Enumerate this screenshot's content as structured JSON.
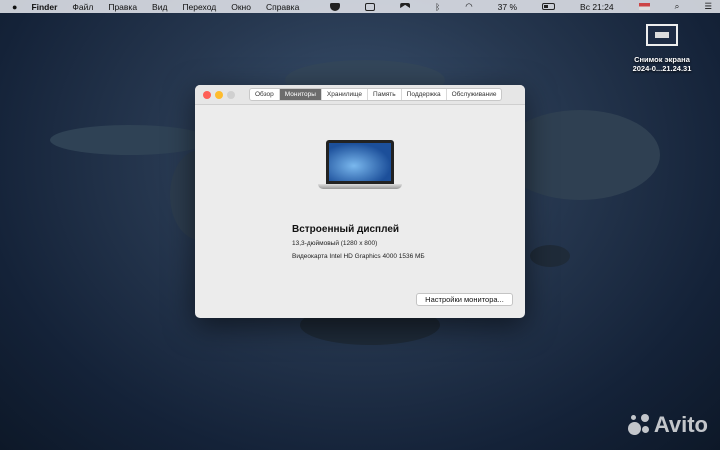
{
  "menubar": {
    "app": "Finder",
    "items": [
      "Файл",
      "Правка",
      "Вид",
      "Переход",
      "Окно",
      "Справка"
    ],
    "battery": "37 %",
    "clock": "Вс 21:24",
    "battery_level": 0.37
  },
  "desktop": {
    "icon_name_line1": "Снимок экрана",
    "icon_name_line2": "2024-0...21.24.31"
  },
  "window": {
    "tabs": [
      "Обзор",
      "Мониторы",
      "Хранилище",
      "Память",
      "Поддержка",
      "Обслуживание"
    ],
    "active_tab": "Мониторы",
    "display_title": "Встроенный дисплей",
    "display_size": "13,3-дюймовый (1280 x 800)",
    "graphics": "Видеокарта Intel HD Graphics 4000 1536 МБ",
    "settings_button": "Настройки монитора..."
  },
  "watermark": "Avito"
}
